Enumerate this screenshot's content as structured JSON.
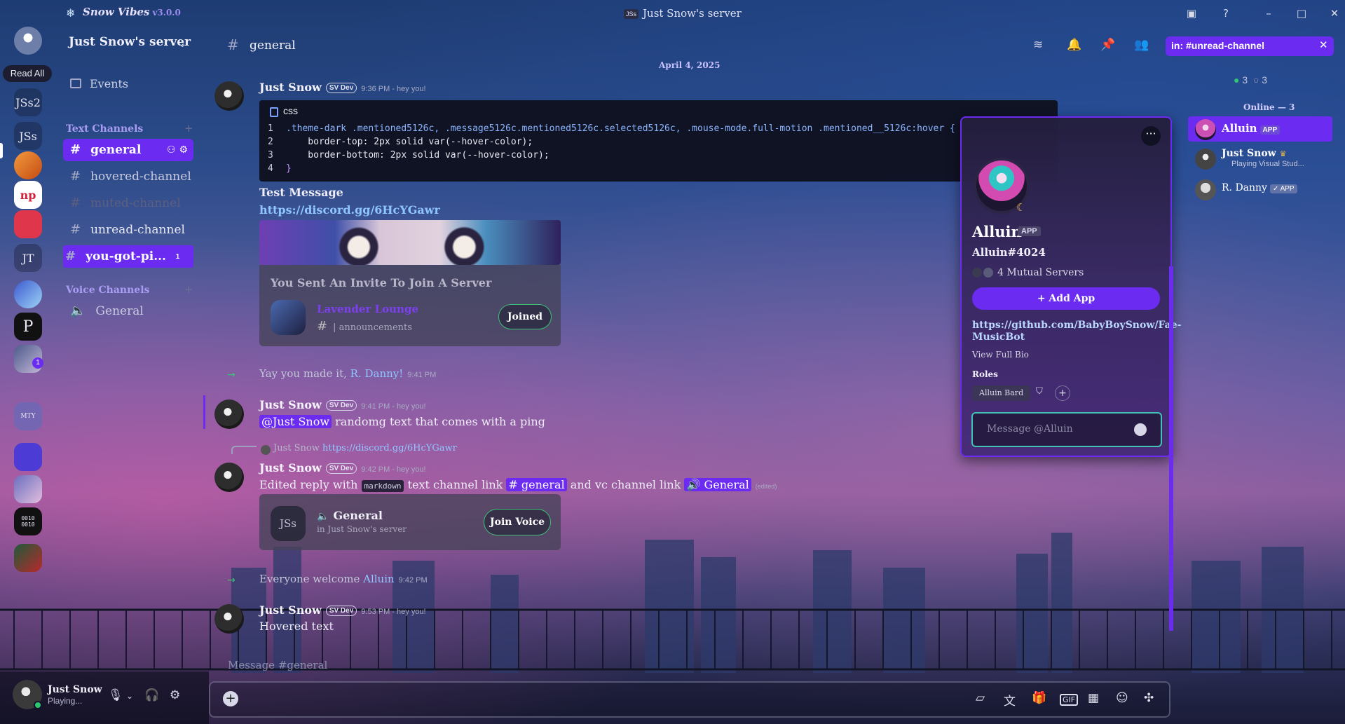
{
  "app": {
    "brand": "Snow Vibes",
    "version": "v3.0.0",
    "window_title": "Just Snow's server",
    "window_badge": "JSs"
  },
  "rail": {
    "read_all": "Read All",
    "servers": [
      {
        "label": "JSs2",
        "badge": ""
      },
      {
        "label": "JSs",
        "badge": "1"
      },
      {
        "label": "JT",
        "badge": ""
      },
      {
        "label": "MTY",
        "badge": ""
      }
    ],
    "folder_badge": "1",
    "binary_icon": "0010\n0010"
  },
  "sidebar": {
    "server_name": "Just Snow's server",
    "events": "Events",
    "text_category": "Text Channels",
    "voice_category": "Voice Channels",
    "channels": [
      {
        "name": "general",
        "state": "active"
      },
      {
        "name": "hovered-channel",
        "state": "normal"
      },
      {
        "name": "muted-channel",
        "state": "muted"
      },
      {
        "name": "unread-channel",
        "state": "unread"
      },
      {
        "name": "you-got-pi...",
        "state": "mention",
        "badge": "1"
      }
    ],
    "voice_channels": [
      {
        "name": "General"
      }
    ]
  },
  "user_panel": {
    "name": "Just Snow",
    "activity": "Playing..."
  },
  "header": {
    "channel": "general",
    "search": "in: #unread-channel"
  },
  "chat": {
    "date": "April 4, 2025",
    "messages": {
      "m1": {
        "author": "Just Snow",
        "tag": "SV Dev",
        "time": "9:36 PM - hey you!"
      },
      "code": {
        "lang": "css",
        "lines": [
          ".theme-dark .mentioned5126c, .message5126c.mentioned5126c.selected5126c, .mouse-mode.full-motion .mentioned__5126c:hover {",
          "    border-top: 2px solid var(--hover-color);",
          "    border-bottom: 2px solid var(--hover-color);",
          "}"
        ]
      },
      "test": "Test Message",
      "invite_link": "https://discord.gg/6HcYGawr",
      "invite": {
        "heading": "You Sent An Invite To Join A Server",
        "server": "Lavender Lounge",
        "channel": "| announcements",
        "button": "Joined"
      },
      "sys1": {
        "text": "Yay you made it, ",
        "user": "R. Danny!",
        "time": "9:41 PM"
      },
      "m2": {
        "author": "Just Snow",
        "tag": "SV Dev",
        "time": "9:41 PM - hey you!",
        "mention": "@Just Snow",
        "text": " randomg text that comes with a ping"
      },
      "reply": {
        "author": "Just Snow",
        "link": "https://discord.gg/6HcYGawr"
      },
      "m3": {
        "author": "Just Snow",
        "tag": "SV Dev",
        "time": "9:42 PM - hey you!",
        "text1": "Edited reply with ",
        "code": "markdown",
        "text2": " text channel link ",
        "chan_link": "# general",
        "text3": " and vc channel link ",
        "vc_link": "🔊 General",
        "edited": "(edited)"
      },
      "voice_invite": {
        "avatar": "JSs",
        "name": "General",
        "sub": "in Just Snow's server",
        "button": "Join Voice"
      },
      "sys2": {
        "text": "Everyone welcome ",
        "user": "Alluin",
        "time": "9:42 PM"
      },
      "m4": {
        "author": "Just Snow",
        "tag": "SV Dev",
        "time": "9:53 PM - hey you!",
        "text": "Hovered text"
      }
    },
    "composer_placeholder": "Message #general"
  },
  "profile": {
    "name": "Alluin",
    "app_tag": "APP",
    "tag": "Alluin#4024",
    "mutual": "4 Mutual Servers",
    "add_app": "+ Add App",
    "bio": "https://github.com/BabyBoySnow/Fae-MusicBot",
    "view_bio": "View Full Bio",
    "roles_title": "Roles",
    "role": "Alluin Bard",
    "dm_placeholder": "Message @Alluin"
  },
  "members": {
    "online_count": "3",
    "offline_count": "3",
    "online_header": "Online — 3",
    "list": [
      {
        "name": "Alluin",
        "tag": "APP",
        "sub": ""
      },
      {
        "name": "Just Snow",
        "tag": "",
        "sub": "Playing Visual Stud..."
      },
      {
        "name": "R. Danny",
        "tag": "✓ APP",
        "sub": ""
      }
    ]
  },
  "colors": {
    "accent": "#6b2bf0",
    "link": "#8fc6ff",
    "online": "#2dc770",
    "focus": "#44c2b5"
  }
}
